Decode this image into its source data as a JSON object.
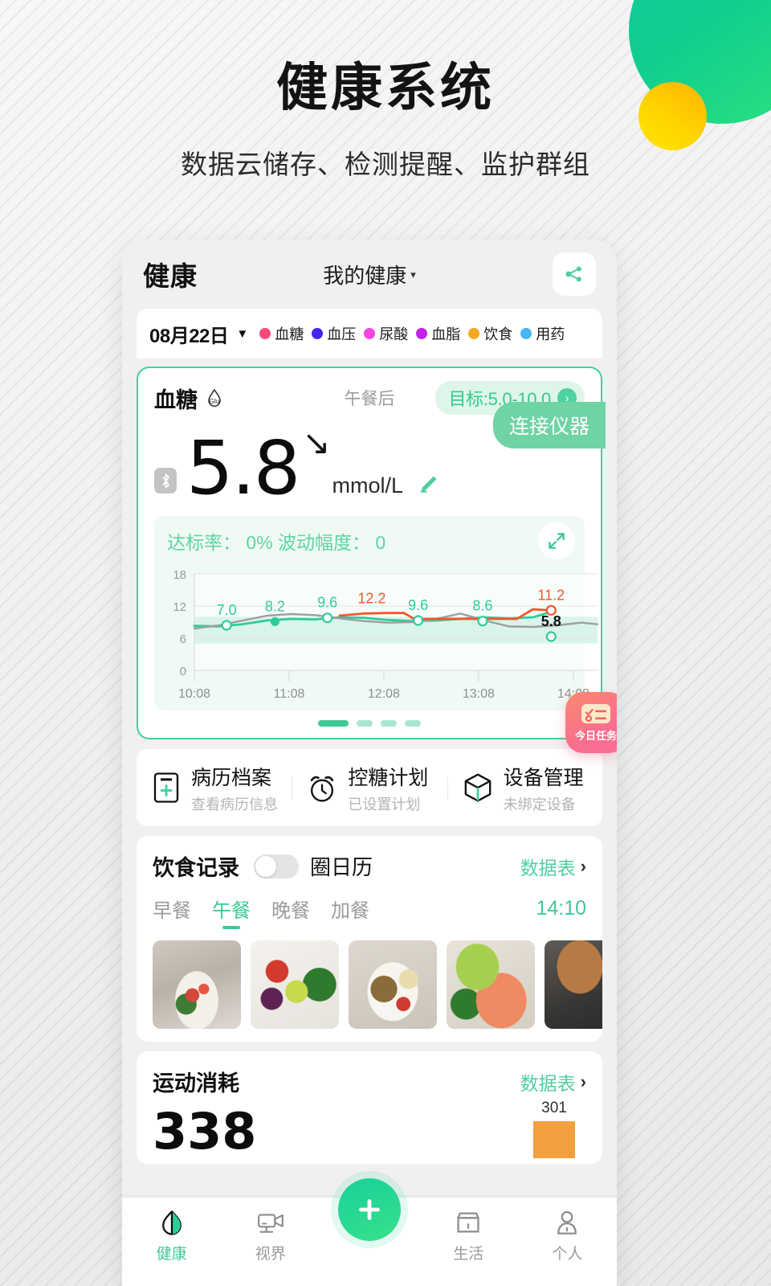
{
  "hero": {
    "title": "健康系统",
    "subtitle": "数据云储存、检测提醒、监护群组"
  },
  "app": {
    "title": "健康",
    "profile_selector": "我的健康",
    "profile_caret": "▾",
    "share_icon": "share-icon"
  },
  "legend_bar": {
    "date": "08月22日",
    "caret": "▼",
    "items": [
      {
        "label": "血糖",
        "color": "#f8497a"
      },
      {
        "label": "血压",
        "color": "#4524f0"
      },
      {
        "label": "尿酸",
        "color": "#f646e0"
      },
      {
        "label": "血脂",
        "color": "#c324e8"
      },
      {
        "label": "饮食",
        "color": "#f5a623"
      },
      {
        "label": "用药",
        "color": "#46b6f5"
      }
    ]
  },
  "glucose": {
    "name": "血糖",
    "unit_badge": "Glu",
    "meal_tag": "午餐后",
    "target_label": "目标:5.0-10.0",
    "target_chevron": "›",
    "bluetooth_icon": "bluetooth-icon",
    "value": "5.8",
    "trend_arrow": "↘",
    "unit": "mmol/L",
    "edit_icon": "pencil-icon",
    "connect_button": "连接仪器",
    "stats": "达标率： 0%  波动幅度： 0",
    "expand_icon": "expand-icon",
    "today_task": "今日任务",
    "pager_count": 4,
    "pager_active": 0
  },
  "chart_data": {
    "type": "line",
    "title": "血糖",
    "xlabel": "",
    "ylabel": "mmol/L",
    "ylim": [
      0,
      18
    ],
    "yticks": [
      0,
      6,
      12,
      18
    ],
    "xticks": [
      "10:08",
      "11:08",
      "12:08",
      "13:08",
      "14:08"
    ],
    "grid": true,
    "target_band": [
      5.0,
      10.0
    ],
    "legend_position": "none",
    "annotations": [
      "7.0",
      "8.2",
      "9.6",
      "12.2",
      "9.6",
      "8.6",
      "11.2",
      "5.8"
    ],
    "series": [
      {
        "name": "血糖-绿",
        "color": "#2ecc9b",
        "x": [
          0.0,
          0.06,
          0.12,
          0.18,
          0.24,
          0.3,
          0.36,
          0.42,
          0.48,
          0.54,
          0.6,
          0.66,
          0.72,
          0.78,
          0.84,
          0.88
        ],
        "values": [
          8.3,
          8.2,
          8.6,
          9.3,
          9.6,
          9.5,
          9.9,
          9.8,
          9.4,
          9.2,
          9.3,
          9.6,
          9.9,
          9.7,
          9.9,
          10.8
        ]
      },
      {
        "name": "血糖-灰",
        "color": "#9e9e9e",
        "x": [
          0.0,
          0.06,
          0.12,
          0.18,
          0.24,
          0.3,
          0.36,
          0.42,
          0.48,
          0.54,
          0.6,
          0.66,
          0.72,
          0.78,
          0.84,
          0.9,
          0.96,
          1.0
        ],
        "values": [
          7.8,
          8.4,
          9.3,
          10.2,
          10.5,
          10.3,
          9.7,
          9.2,
          8.9,
          9.0,
          9.6,
          10.6,
          9.3,
          8.2,
          8.1,
          8.4,
          8.9,
          8.6
        ]
      },
      {
        "name": "血糖-橙(高)",
        "color": "#f4552a",
        "x": [
          0.36,
          0.42,
          0.48,
          0.52,
          0.545,
          0.8,
          0.84,
          0.88
        ],
        "values": [
          10.2,
          10.6,
          10.7,
          10.7,
          9.6,
          9.6,
          11.4,
          11.2
        ]
      }
    ],
    "points": [
      {
        "label": "7.0",
        "x": 0.08,
        "y": 8.4,
        "color": "#2ecc9b",
        "style": "hollow"
      },
      {
        "label": "8.2",
        "x": 0.2,
        "y": 9.1,
        "color": "#2ecc9b",
        "style": "solid"
      },
      {
        "label": "9.6",
        "x": 0.33,
        "y": 9.8,
        "color": "#2ecc9b",
        "style": "hollow"
      },
      {
        "label": "12.2",
        "x": 0.44,
        "y": 10.6,
        "color": "#f4552a",
        "style": "none"
      },
      {
        "label": "9.6",
        "x": 0.555,
        "y": 9.3,
        "color": "#2ecc9b",
        "style": "hollow"
      },
      {
        "label": "8.6",
        "x": 0.715,
        "y": 9.2,
        "color": "#2ecc9b",
        "style": "hollow"
      },
      {
        "label": "11.2",
        "x": 0.885,
        "y": 11.2,
        "color": "#f4552a",
        "style": "hollow"
      },
      {
        "label": "5.8",
        "x": 0.885,
        "y": 6.3,
        "color": "#2ecc9b",
        "style": "hollow"
      }
    ]
  },
  "quick_links": [
    {
      "icon": "medical-record-icon",
      "title": "病历档案",
      "sub": "查看病历信息"
    },
    {
      "icon": "alarm-clock-icon",
      "title": "控糖计划",
      "sub": "已设置计划"
    },
    {
      "icon": "box-icon",
      "title": "设备管理",
      "sub": "未绑定设备"
    }
  ],
  "diet": {
    "title": "饮食记录",
    "toggle_state": "off",
    "toggle_label": "圈日历",
    "datasheet_label": "数据表",
    "chevron": "›",
    "tabs": [
      "早餐",
      "午餐",
      "晚餐",
      "加餐"
    ],
    "active_tab": 1,
    "time": "14:10",
    "photos": [
      "沙拉碗",
      "牛油果藜麦餐",
      "鸡肉谷物碗",
      "三文鱼牛油果",
      "饮品"
    ]
  },
  "exercise": {
    "title": "运动消耗",
    "datasheet_label": "数据表",
    "chevron": "›",
    "value": "338",
    "bar_label": "301"
  },
  "tabbar": {
    "items": [
      {
        "icon": "leaf-health-icon",
        "label": "健康",
        "active": true
      },
      {
        "icon": "video-camera-icon",
        "label": "视界",
        "active": false
      },
      {
        "icon": "store-icon",
        "label": "生活",
        "active": false
      },
      {
        "icon": "person-icon",
        "label": "个人",
        "active": false
      }
    ],
    "fab_icon": "plus-icon"
  },
  "colors": {
    "brand_green": "#3fc995",
    "accent_orange": "#f4552a",
    "grey_line": "#9e9e9e",
    "task_pink": "#f86c98"
  }
}
